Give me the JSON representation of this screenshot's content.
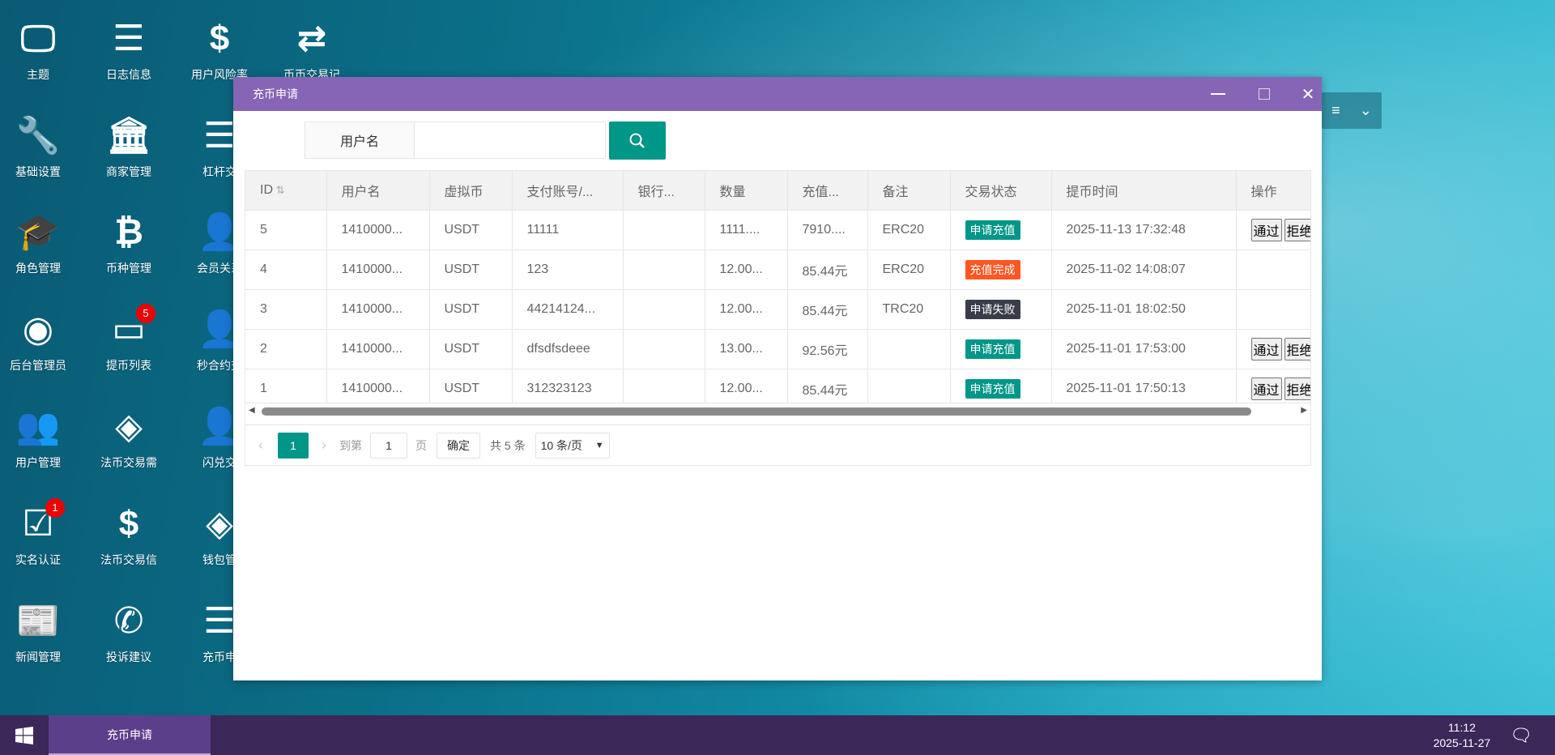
{
  "desktop": {
    "icons": [
      {
        "label": "主题",
        "icon": "monitor-icon"
      },
      {
        "label": "日志信息",
        "icon": "list-icon"
      },
      {
        "label": "用户风险率",
        "icon": "dollar-icon"
      },
      {
        "label": "币币交易记",
        "icon": "exchange-arrows-icon"
      },
      {
        "label": "基础设置",
        "icon": "wrench-icon"
      },
      {
        "label": "商家管理",
        "icon": "bank-icon"
      },
      {
        "label": "杠杆交",
        "icon": "list-icon"
      },
      {
        "label": "角色管理",
        "icon": "graduation-cap-icon"
      },
      {
        "label": "币种管理",
        "icon": "bitcoin-icon"
      },
      {
        "label": "会员关系",
        "icon": "user-plus-icon"
      },
      {
        "label": "后台管理员",
        "icon": "user-circle-icon"
      },
      {
        "label": "提币列表",
        "icon": "credit-card-icon",
        "badge": "5"
      },
      {
        "label": "秒合约交",
        "icon": "user-plus-icon"
      },
      {
        "label": "用户管理",
        "icon": "users-icon"
      },
      {
        "label": "法币交易需",
        "icon": "link-circle-icon"
      },
      {
        "label": "闪兑交",
        "icon": "user-plus-icon"
      },
      {
        "label": "实名认证",
        "icon": "check-square-icon",
        "badge": "1"
      },
      {
        "label": "法币交易信",
        "icon": "dollar-icon"
      },
      {
        "label": "钱包管",
        "icon": "link-circle-icon"
      },
      {
        "label": "新闻管理",
        "icon": "newspaper-icon"
      },
      {
        "label": "投诉建议",
        "icon": "phone-volume-icon"
      },
      {
        "label": "充币申",
        "icon": "list-icon"
      }
    ]
  },
  "window": {
    "title": "充币申请",
    "search": {
      "label": "用户名",
      "value": "",
      "placeholder": ""
    },
    "table": {
      "columns": [
        "ID",
        "用户名",
        "虚拟币",
        "支付账号/...",
        "银行...",
        "数量",
        "充值...",
        "备注",
        "交易状态",
        "提币时间",
        "操作"
      ],
      "rows": [
        {
          "id": "5",
          "user": "1410000...",
          "coin": "USDT",
          "account": "11111",
          "bank": "",
          "qty": "1111....",
          "amount": "7910....",
          "note": "ERC20",
          "status": "申请充值",
          "status_color": "#009688",
          "time": "2025-11-13 17:32:48",
          "actions": true
        },
        {
          "id": "4",
          "user": "1410000...",
          "coin": "USDT",
          "account": "123",
          "bank": "",
          "qty": "12.00...",
          "amount": "85.44元",
          "note": "ERC20",
          "status": "充值完成",
          "status_color": "#ff5722",
          "time": "2025-11-02 14:08:07",
          "actions": false
        },
        {
          "id": "3",
          "user": "1410000...",
          "coin": "USDT",
          "account": "44214124...",
          "bank": "",
          "qty": "12.00...",
          "amount": "85.44元",
          "note": "TRC20",
          "status": "申请失败",
          "status_color": "#393d49",
          "time": "2025-11-01 18:02:50",
          "actions": false
        },
        {
          "id": "2",
          "user": "1410000...",
          "coin": "USDT",
          "account": "dfsdfsdeee",
          "bank": "",
          "qty": "13.00...",
          "amount": "92.56元",
          "note": "",
          "status": "申请充值",
          "status_color": "#009688",
          "time": "2025-11-01 17:53:00",
          "actions": true
        },
        {
          "id": "1",
          "user": "1410000...",
          "coin": "USDT",
          "account": "312323123",
          "bank": "",
          "qty": "12.00...",
          "amount": "85.44元",
          "note": "",
          "status": "申请充值",
          "status_color": "#009688",
          "time": "2025-11-01 17:50:13",
          "actions": true
        }
      ],
      "approve_label": "通过",
      "reject_label": "拒绝"
    },
    "pager": {
      "current": "1",
      "goto_label": "到第",
      "goto_value": "1",
      "page_unit": "页",
      "confirm": "确定",
      "total": "共 5 条",
      "page_size": "10 条/页"
    }
  },
  "taskbar": {
    "task": "充币申请",
    "time": "11:12",
    "date": "2025-11-27"
  },
  "colors": {
    "accent": "#009688",
    "titlebar": "#8765b6",
    "taskbar": "#3c2759"
  }
}
